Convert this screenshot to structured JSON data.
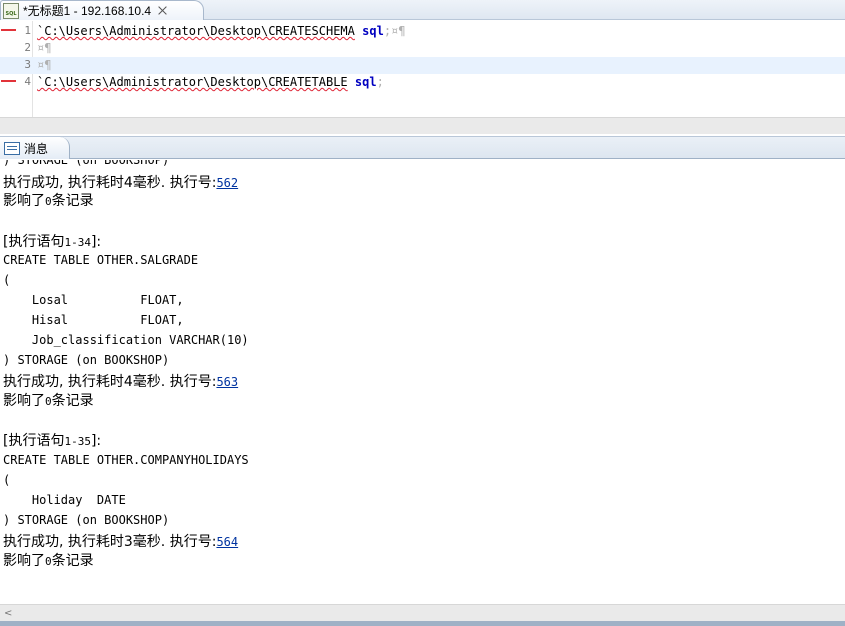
{
  "editor_tab": {
    "icon": "sql-file-icon",
    "icon_text": "SQL",
    "title": "*无标题1 - 192.168.10.4"
  },
  "editor": {
    "lines": [
      {
        "num": "1",
        "path": "`C:\\Users\\Administrator\\Desktop\\CREATESCHEMA",
        "ext": "sql",
        "trail": ";¤¶"
      },
      {
        "num": "2",
        "text": "¤¶"
      },
      {
        "num": "3",
        "text": "¤¶"
      },
      {
        "num": "4",
        "path": "`C:\\Users\\Administrator\\Desktop\\CREATETABLE",
        "ext": "sql",
        "trail": ";"
      }
    ]
  },
  "messages_view": {
    "icon": "message-icon",
    "title": "消息",
    "lines": {
      "cut_top": ") STORAGE (on BOOKSHOP)",
      "b1_success": "执行成功, 执行耗时4毫秒. 执行号:",
      "b1_exec_no": "562",
      "b1_affected_pre": "影响了",
      "b1_affected_num": "0",
      "b1_affected_post": "条记录",
      "b2_header_pre": "[执行语句",
      "b2_header_num": "1-34",
      "b2_header_post": "]:",
      "b2_sql1": "CREATE TABLE OTHER.SALGRADE",
      "b2_sql2": "(",
      "b2_sql3": "    Losal          FLOAT,",
      "b2_sql4": "    Hisal          FLOAT,",
      "b2_sql5": "    Job_classification VARCHAR(10)",
      "b2_sql6": ") STORAGE (on BOOKSHOP)",
      "b2_success": "执行成功, 执行耗时4毫秒. 执行号:",
      "b2_exec_no": "563",
      "b2_affected_pre": "影响了",
      "b2_affected_num": "0",
      "b2_affected_post": "条记录",
      "b3_header_pre": "[执行语句",
      "b3_header_num": "1-35",
      "b3_header_post": "]:",
      "b3_sql1": "CREATE TABLE OTHER.COMPANYHOLIDAYS",
      "b3_sql2": "(",
      "b3_sql3": "    Holiday  DATE",
      "b3_sql4": ") STORAGE (on BOOKSHOP)",
      "b3_success": "执行成功, 执行耗时3毫秒. 执行号:",
      "b3_exec_no": "564",
      "b3_affected_pre": "影响了",
      "b3_affected_num": "0",
      "b3_affected_post": "条记录"
    }
  },
  "scrollbar": {
    "left_arrow": "<"
  }
}
